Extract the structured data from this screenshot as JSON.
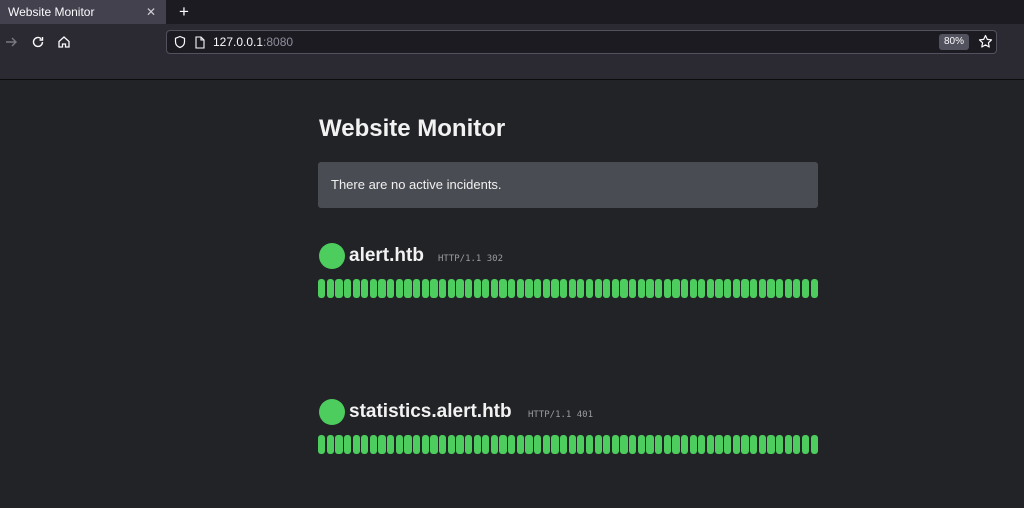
{
  "browser": {
    "tab_title": "Website Monitor",
    "tab_close": "✕",
    "new_tab": "+",
    "url_host": "127.0.0.1",
    "url_port": ":8080",
    "zoom": "80%"
  },
  "page": {
    "title": "Website Monitor",
    "incident_message": "There are no active incidents."
  },
  "sites": [
    {
      "name": "alert.htb",
      "status": "HTTP/1.1 302",
      "bar_count": 58,
      "color": "#4ccd5e"
    },
    {
      "name": "statistics.alert.htb",
      "status": "HTTP/1.1 401",
      "bar_count": 58,
      "color": "#4ccd5e"
    }
  ],
  "colors": {
    "up": "#4ccd5e",
    "background": "#222326",
    "incident_box": "#4a4c53"
  }
}
